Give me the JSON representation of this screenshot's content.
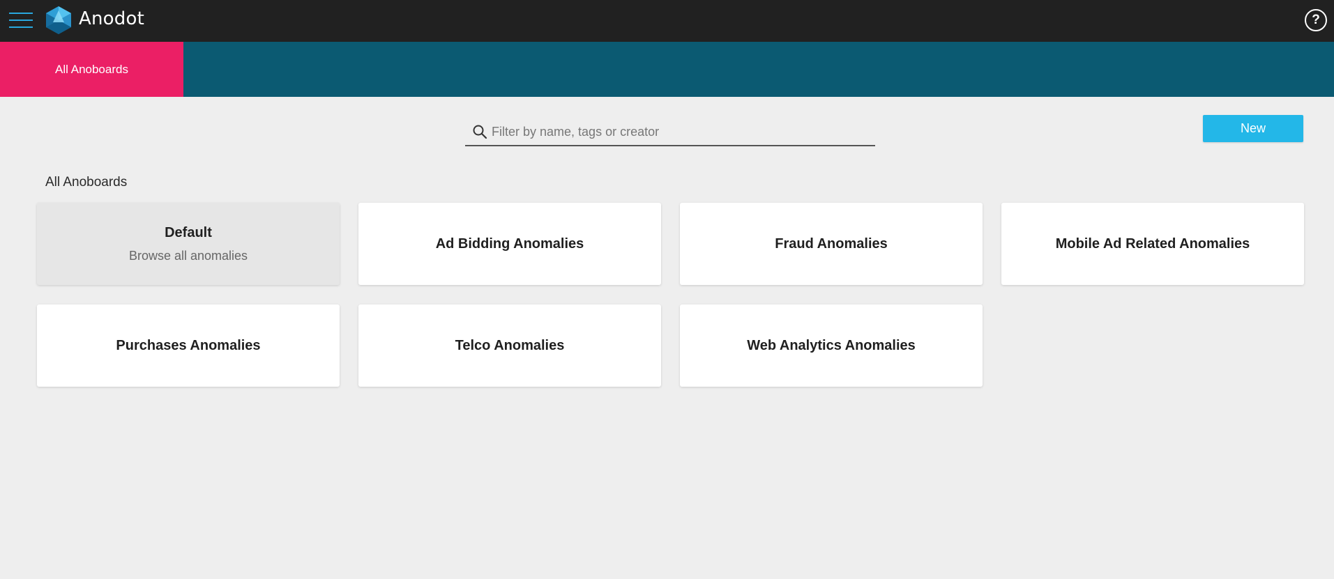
{
  "app": {
    "name": "Anodot"
  },
  "header": {
    "help_label": "?"
  },
  "tabs": [
    {
      "label": "All Anoboards",
      "active": true
    }
  ],
  "search": {
    "placeholder": "Filter by name, tags or creator",
    "value": ""
  },
  "toolbar": {
    "new_label": "New"
  },
  "section": {
    "title": "All Anoboards"
  },
  "cards": [
    {
      "title": "Default",
      "subtitle": "Browse all anomalies"
    },
    {
      "title": "Ad Bidding Anomalies"
    },
    {
      "title": "Fraud Anomalies"
    },
    {
      "title": "Mobile Ad Related Anomalies"
    },
    {
      "title": "Purchases Anomalies"
    },
    {
      "title": "Telco Anomalies"
    },
    {
      "title": "Web Analytics Anomalies"
    }
  ],
  "colors": {
    "topbar": "#212121",
    "tabstrip": "#0b5a72",
    "active_tab": "#eb1f65",
    "accent": "#23b7e8",
    "hamburger": "#29a8df"
  },
  "icons": [
    "hamburger-menu-icon",
    "anodot-logo-icon",
    "help-icon",
    "search-icon"
  ]
}
